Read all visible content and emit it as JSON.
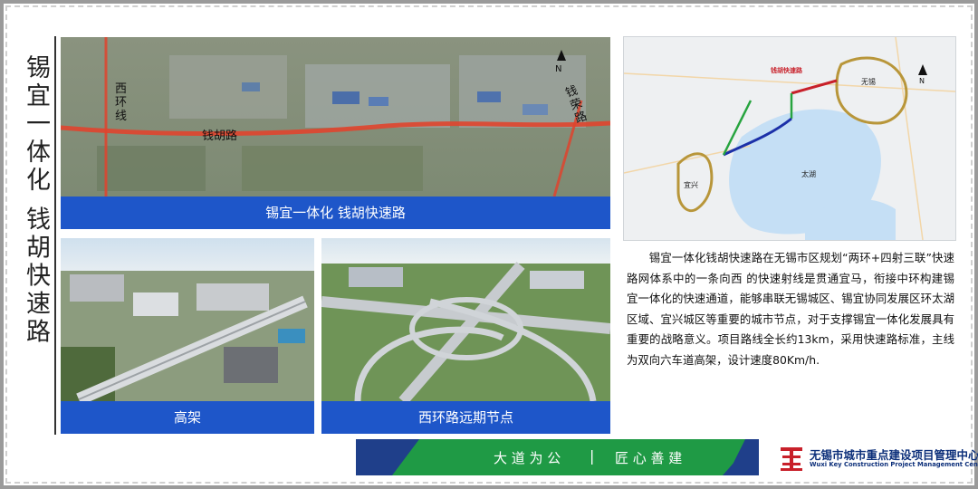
{
  "page": {
    "title_vertical": "锡宜一体化 钱胡快速路"
  },
  "top_image": {
    "caption": "锡宜一体化 钱胡快速路",
    "labels": {
      "west_ring": "西环线",
      "road": "钱胡路",
      "east_road": "钱荣路",
      "north": "N"
    }
  },
  "left_image": {
    "caption": "高架"
  },
  "right_image": {
    "caption": "西环路远期节点"
  },
  "map": {
    "labels": {
      "expressway": "钱胡快速路",
      "wuxi": "无锡",
      "yixing": "宜兴",
      "taihu": "太湖",
      "north": "N"
    }
  },
  "description": "锡宜一体化钱胡快速路在无锡市区规划“两环+四射三联”快速路网体系中的一条向西 的快速射线是贯通宜马，衔接中环构建锡宜一体化的快速通道，能够串联无锡城区、锡宜协同发展区环太湖区域、宜兴城区等重要的城市节点，对于支撑锡宜一体化发展具有重要的战略意义。项目路线全长约13km，采用快速路标准，主线为双向六车道高架，设计速度80Km/h.",
  "slogan": {
    "left": "大 道 为 公",
    "separator": "|",
    "right": "匠 心 善 建"
  },
  "logo": {
    "cn": "无锡市城市重点建设项目管理中心",
    "en": "Wuxi Key Construction Project Management Center"
  },
  "colors": {
    "caption_blue": "#1e56c9",
    "slogan_navy": "#1f3f8a",
    "slogan_green": "#1f9a45",
    "road_red": "#e0442e",
    "map_red": "#c8202a",
    "map_green": "#27a43f",
    "map_blue": "#1c30a8",
    "map_gold": "#b8963a"
  }
}
